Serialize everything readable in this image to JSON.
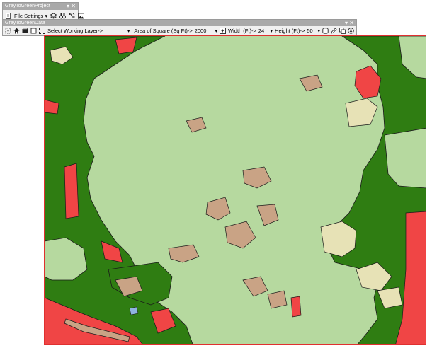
{
  "project_toolbar": {
    "title": "GreyToGreenProject",
    "file_settings_label": "File Settings",
    "dropdown_arrow": "▾",
    "close_symbol": "✕",
    "pin_symbol": "▾",
    "icons": [
      "layers-icon",
      "binoculars-icon",
      "route-icon",
      "image-icon"
    ]
  },
  "data_toolbar": {
    "title": "GreyToGreenData",
    "working_layer_label": "Select Working Layer->",
    "area_label": "Area of Square (Sq Ft)->",
    "area_value": "2000",
    "width_label": "Width (Ft)->",
    "width_value": "24",
    "height_label": "Height (Ft)->",
    "height_value": "50",
    "close_symbol": "✕",
    "pin_symbol": "▾",
    "icons": [
      "select-icon",
      "home-icon",
      "layer-icon",
      "square-icon",
      "expand-icon",
      "rectangle-icon",
      "circle-icon",
      "pencil-icon",
      "copy-icon",
      "cancel-icon"
    ]
  },
  "map": {
    "colors": {
      "lawn": "#b6d99f",
      "tree_canopy": "#2f7d12",
      "impervious": "#f04545",
      "bare_soil": "#c9a385",
      "sand": "#e7e2b6",
      "water": "#8fb3e0",
      "outline": "#1a1a1a",
      "frame_border": "#e03030"
    }
  }
}
